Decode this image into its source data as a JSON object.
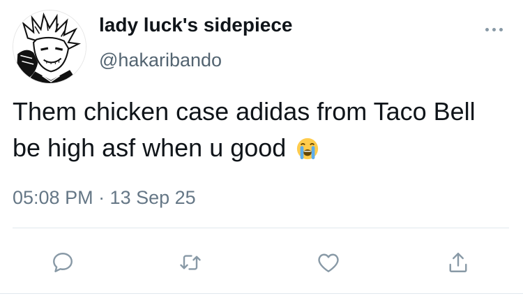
{
  "author": {
    "display_name": "lady luck's sidepiece",
    "handle": "@hakaribando",
    "avatar_icon": "manga-character-avatar"
  },
  "tweet": {
    "text": "Them chicken case adidas from Taco Bell be high asf when u good",
    "emoji": "loudly-crying-face",
    "timestamp": "05:08 PM · 13 Sep 25"
  },
  "actions": {
    "reply_icon": "reply-icon",
    "retweet_icon": "retweet-icon",
    "like_icon": "heart-icon",
    "share_icon": "share-icon"
  },
  "colors": {
    "text": "#0f1419",
    "secondary_text": "#657786",
    "icon": "#8899a6",
    "divider": "#e1e8ed"
  }
}
